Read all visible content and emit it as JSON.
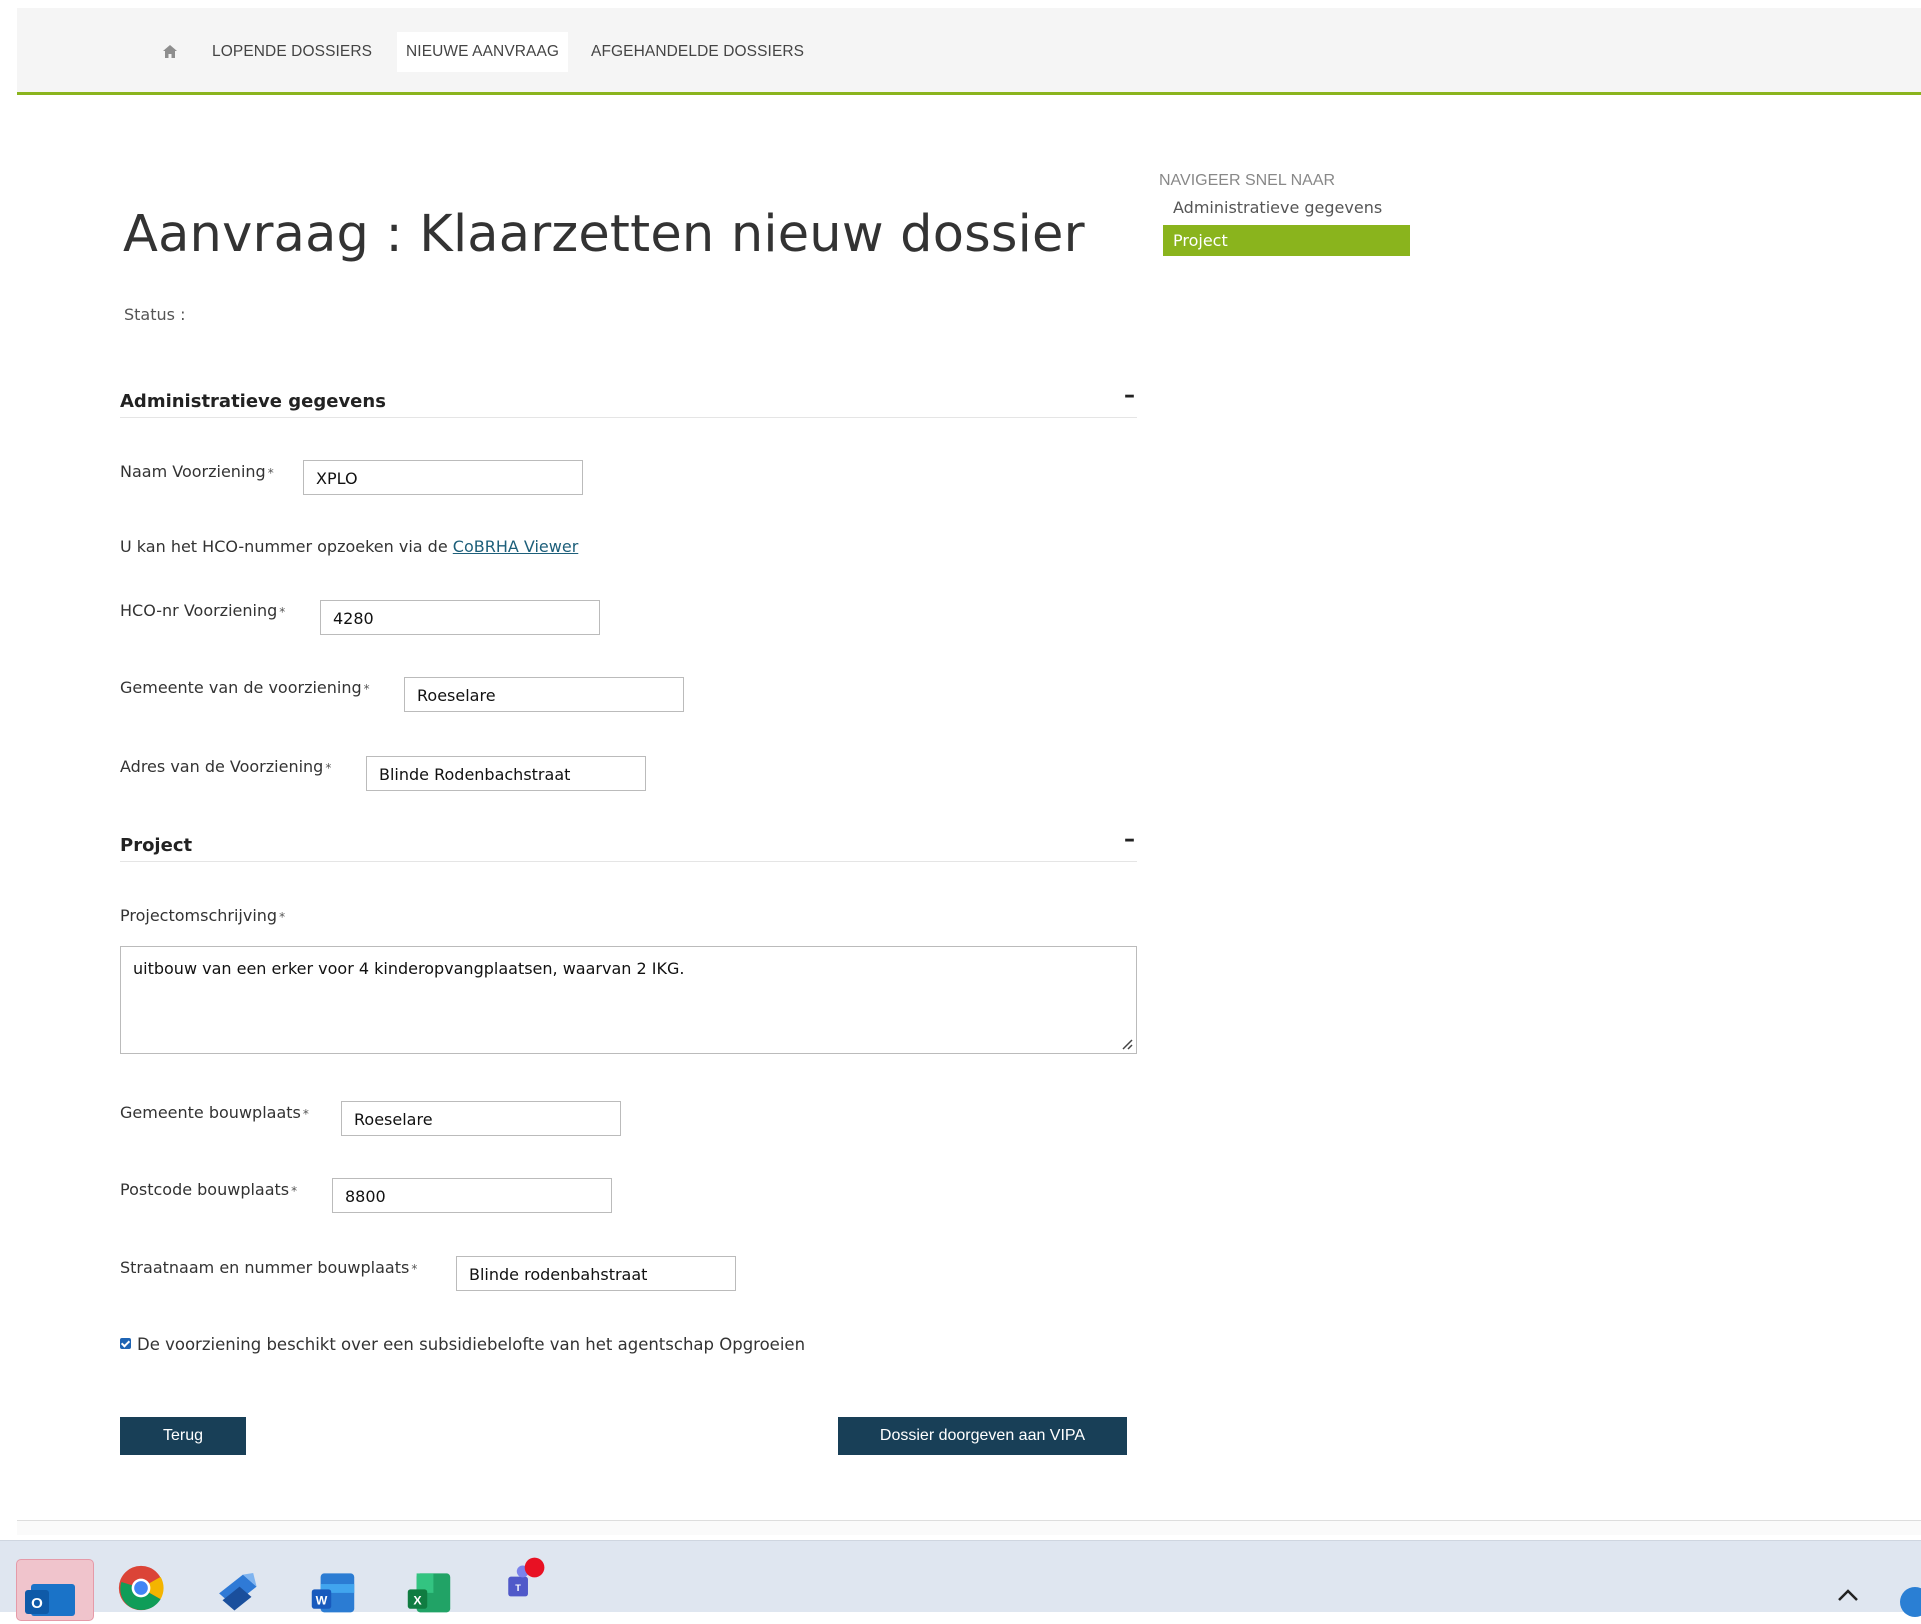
{
  "topnav": {
    "home_icon": "home-icon",
    "links": [
      {
        "label": "LOPENDE DOSSIERS",
        "active": false
      },
      {
        "label": "NIEUWE AANVRAAG",
        "active": true
      },
      {
        "label": "AFGEHANDELDE DOSSIERS",
        "active": false
      }
    ]
  },
  "page": {
    "title": "Aanvraag : Klaarzetten nieuw dossier",
    "status_label": "Status :"
  },
  "sections": {
    "admin": {
      "title": "Administratieve gegevens",
      "toggle": "–"
    },
    "project": {
      "title": "Project",
      "toggle": "–"
    }
  },
  "form": {
    "naam_voorziening": {
      "label": "Naam Voorziening",
      "value": "XPLO"
    },
    "help_prefix": "U kan het HCO-nummer opzoeken via de ",
    "help_link": "CoBRHA Viewer",
    "hco_nr": {
      "label": "HCO-nr Voorziening",
      "value": "4280"
    },
    "gemeente_voorziening": {
      "label": "Gemeente van de voorziening",
      "value": "Roeselare"
    },
    "adres_voorziening": {
      "label": "Adres van de Voorziening",
      "value": "Blinde Rodenbachstraat"
    },
    "projectomschrijving": {
      "label": "Projectomschrijving",
      "value": "uitbouw van een erker voor 4 kinderopvangplaatsen, waarvan 2 IKG."
    },
    "gemeente_bouwplaats": {
      "label": "Gemeente bouwplaats",
      "value": "Roeselare"
    },
    "postcode_bouwplaats": {
      "label": "Postcode bouwplaats",
      "value": "8800"
    },
    "straat_bouwplaats": {
      "label": "Straatnaam en nummer bouwplaats",
      "value": "Blinde rodenbahstraat"
    },
    "required_marker": "*",
    "subsidie": {
      "label": "De voorziening beschikt over een subsidiebelofte van het agentschap Opgroeien",
      "checked": true
    }
  },
  "buttons": {
    "back": "Terug",
    "submit": "Dossier doorgeven aan VIPA"
  },
  "quicknav": {
    "title": "NAVIGEER SNEL NAAR",
    "items": [
      {
        "label": "Administratieve gegevens",
        "active": false
      },
      {
        "label": "Project",
        "active": true
      }
    ]
  },
  "colors": {
    "accent_green": "#8ab41d",
    "button_navy": "#183f57",
    "link": "#1d5f7a"
  },
  "taskbar": {
    "icons": [
      "outlook-icon",
      "chrome-icon",
      "sticky-app-icon",
      "word-icon",
      "excel-icon",
      "teams-icon"
    ]
  }
}
